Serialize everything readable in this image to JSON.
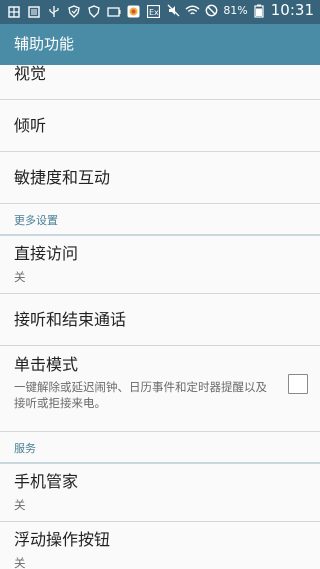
{
  "status_bar": {
    "battery": "81%",
    "time": "10:31",
    "left_icons": [
      "menu-grid-icon",
      "message-icon",
      "usb-icon",
      "shield-icon",
      "shield-icon",
      "battery-saver-icon",
      "color-app-icon",
      "ex-icon"
    ],
    "right_icons": [
      "mute-icon",
      "wifi-icon",
      "dnd-icon",
      "battery-icon"
    ]
  },
  "app_bar": {
    "title": "辅助功能"
  },
  "items": [
    {
      "title": "视觉"
    },
    {
      "title": "倾听"
    },
    {
      "title": "敏捷度和互动"
    }
  ],
  "section_more": {
    "title": "更多设置"
  },
  "more_items": [
    {
      "title": "直接访问",
      "subtitle": "关"
    },
    {
      "title": "接听和结束通话"
    },
    {
      "title": "单击模式",
      "subtitle": "一键解除或延迟闹钟、日历事件和定时器提醒以及接听或拒接来电。"
    }
  ],
  "section_services": {
    "title": "服务"
  },
  "services_items": [
    {
      "title": "手机管家",
      "subtitle": "关"
    },
    {
      "title": "浮动操作按钮",
      "subtitle": "关"
    }
  ]
}
